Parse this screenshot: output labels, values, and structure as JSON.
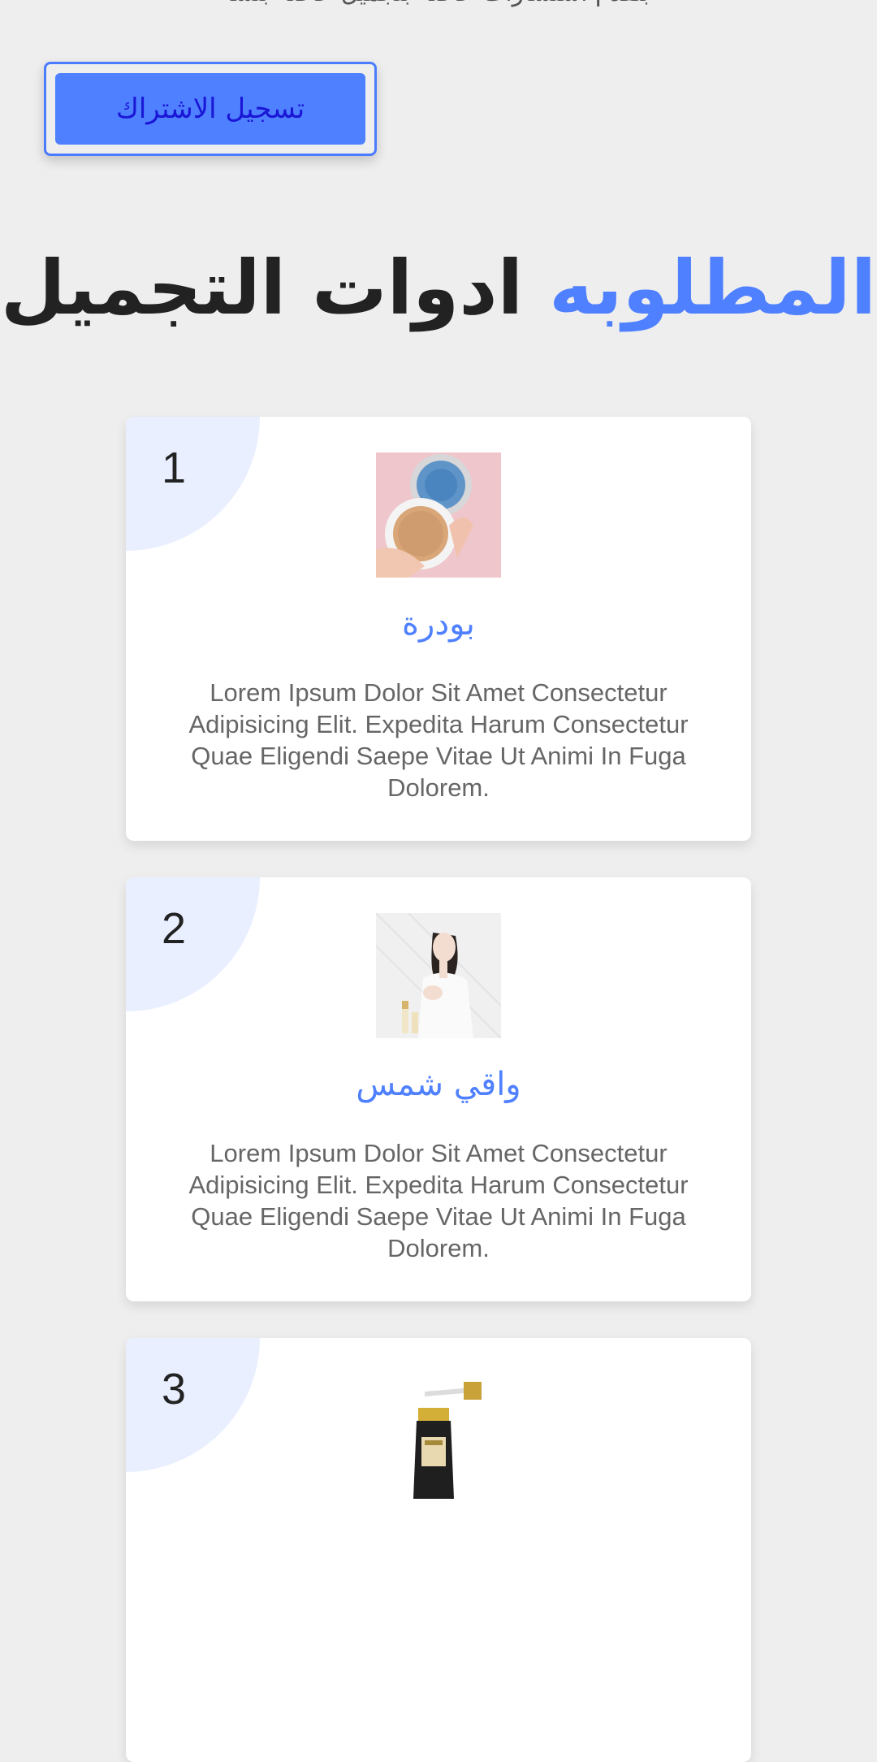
{
  "header": {
    "partial_text": "بتقدم استشارات خاصة بتجميل خاصة بنساء"
  },
  "subscribe_button": {
    "label": "تسجيل الاشتراك"
  },
  "section_title": {
    "accent": "المطلوبه",
    "main": "ادوات التجميل"
  },
  "colors": {
    "accent": "#4f80ff",
    "button_text": "#1a16d6",
    "background": "#eeeeee",
    "card_corner": "#e9efff"
  },
  "cards": [
    {
      "number": "1",
      "image_icon": "powder-compact-image",
      "title": "بودرة",
      "description": "Lorem Ipsum Dolor Sit Amet Consectetur Adipisicing Elit. Expedita Harum Consectetur Quae Eligendi Saepe Vitae Ut Animi In Fuga Dolorem."
    },
    {
      "number": "2",
      "image_icon": "sunscreen-model-image",
      "title": "واقي شمس",
      "description": "Lorem Ipsum Dolor Sit Amet Consectetur Adipisicing Elit. Expedita Harum Consectetur Quae Eligendi Saepe Vitae Ut Animi In Fuga Dolorem."
    },
    {
      "number": "3",
      "image_icon": "serum-bottle-image"
    }
  ]
}
